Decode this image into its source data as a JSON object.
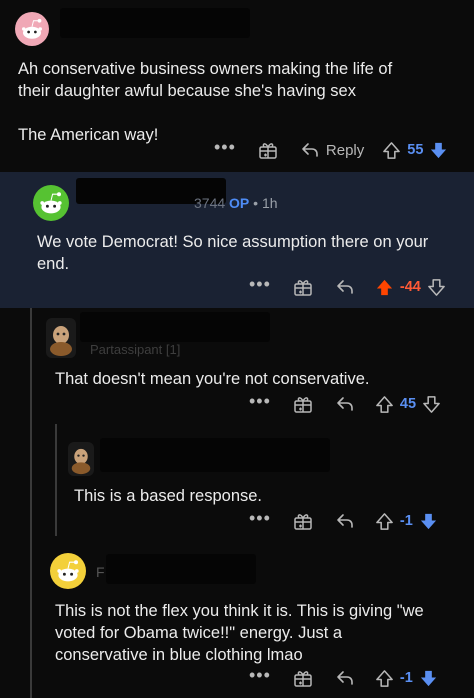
{
  "comments": [
    {
      "username": "",
      "text": "Ah conservative business owners making the life of\ntheir daughter awful because she's having sex\n\nThe American way!",
      "more": "•••",
      "reply_label": "Reply",
      "score": "55",
      "vote_state": "downvoted",
      "avatar_color": "#f0a8b6"
    },
    {
      "username": "3744",
      "op_badge": "OP",
      "time": "• 1h",
      "text": "We vote Democrat! So nice assumption there on your\nend.",
      "more": "•••",
      "score": "-44",
      "vote_state": "upvoted",
      "avatar_color": "#56c232"
    },
    {
      "username": "Partassipant [1]",
      "text": "That doesn't mean you're not conservative.",
      "more": "•••",
      "score": "45",
      "vote_state": "none"
    },
    {
      "username": "",
      "text": "This is a based response.",
      "more": "•••",
      "score": "-1",
      "vote_state": "downvoted"
    },
    {
      "username": "F",
      "text": "This is not the flex you think it is. This is giving \"we\nvoted for Obama twice!!\" energy. Just a\nconservative in blue clothing lmao",
      "more": "•••",
      "score": "-1",
      "vote_state": "downvoted",
      "avatar_color": "#f3d03a"
    }
  ],
  "colors": {
    "background": "#0b0b0b",
    "highlight": "#1a2233",
    "upvote": "#ff4500",
    "downvote": "#5a8ff2"
  }
}
